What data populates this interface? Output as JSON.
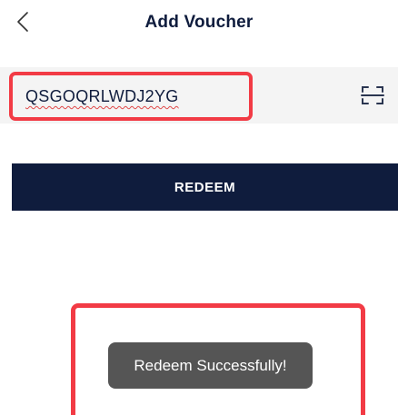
{
  "header": {
    "title": "Add Voucher",
    "back_icon": "chevron-left-icon"
  },
  "voucher": {
    "code": "QSGOQRLWDJ2YG",
    "scan_icon": "scan-icon"
  },
  "redeem_button": {
    "label": "REDEEM"
  },
  "toast": {
    "message": "Redeem Successfully!"
  },
  "colors": {
    "primary": "#0f1c3d",
    "highlight": "#f23b45",
    "toast_bg": "#555555",
    "input_row_bg": "#f4f4f4"
  }
}
